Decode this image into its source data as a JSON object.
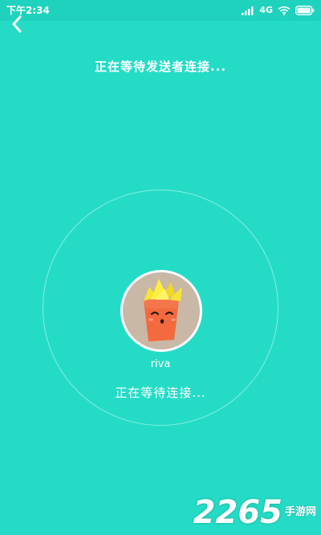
{
  "status_bar": {
    "time": "下午2:34",
    "network": "4G",
    "signal_icon": "signal-bars-icon",
    "wifi_icon": "wifi-icon",
    "battery_icon": "battery-icon"
  },
  "header": {
    "back_icon": "chevron-left-icon",
    "title": "正在等待发送者连接..."
  },
  "device": {
    "avatar_icon": "carrot-avatar-icon",
    "name": "riva",
    "status": "正在等待连接..."
  },
  "watermark": {
    "number": "2265",
    "text": "手游网"
  },
  "colors": {
    "background": "#24dcc6",
    "text": "#ffffff"
  }
}
